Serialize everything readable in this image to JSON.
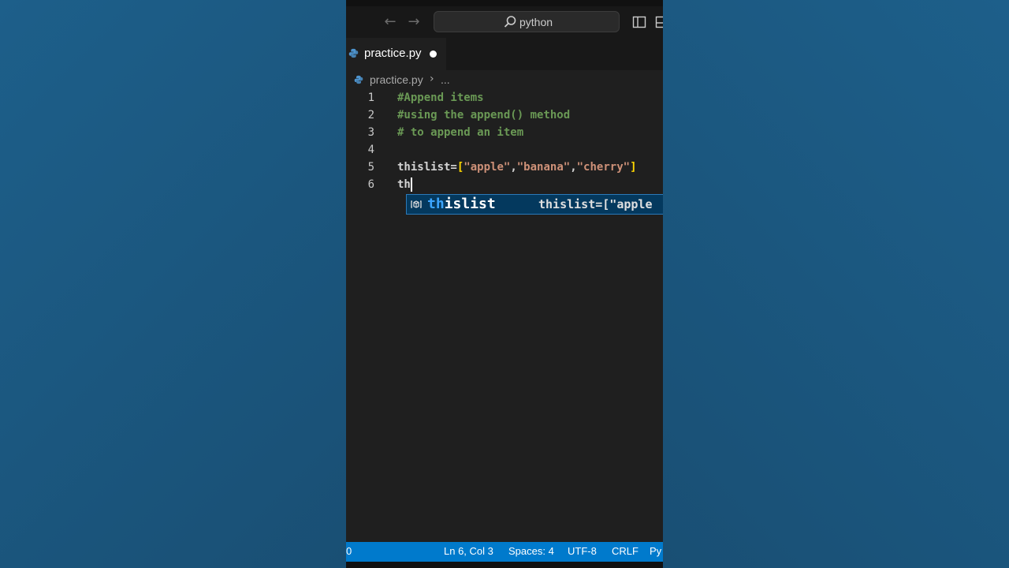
{
  "titlebar": {
    "search_text": "python",
    "back_icon": "arrow-left-icon",
    "forward_icon": "arrow-right-icon"
  },
  "tab": {
    "label": "practice.py",
    "unsaved": true
  },
  "breadcrumb": {
    "file": "practice.py",
    "more": "..."
  },
  "editor": {
    "lines": [
      {
        "number": "1",
        "text": "#Append items"
      },
      {
        "number": "2",
        "text": "#using the append() method"
      },
      {
        "number": "3",
        "text": "# to append an item"
      },
      {
        "number": "4",
        "text": ""
      },
      {
        "number": "5",
        "tokens": [
          "thislist=",
          "[",
          "\"apple\"",
          ",",
          "\"banana\"",
          ",",
          "\"cherry\"",
          "]"
        ]
      },
      {
        "number": "6",
        "text": "th"
      }
    ]
  },
  "suggestion": {
    "match": "th",
    "rest": "islist",
    "detail": "thislist=[\"apple"
  },
  "statusbar": {
    "left": "0",
    "position": "Ln 6, Col 3",
    "spaces": "Spaces: 4",
    "encoding": "UTF-8",
    "eol": "CRLF",
    "language": "Py"
  },
  "colors": {
    "background": "#1b5a84",
    "editor_bg": "#1f1f1f",
    "statusbar": "#007acc",
    "comment": "#6a9955",
    "string": "#ce9178",
    "bracket": "#ffd700"
  }
}
